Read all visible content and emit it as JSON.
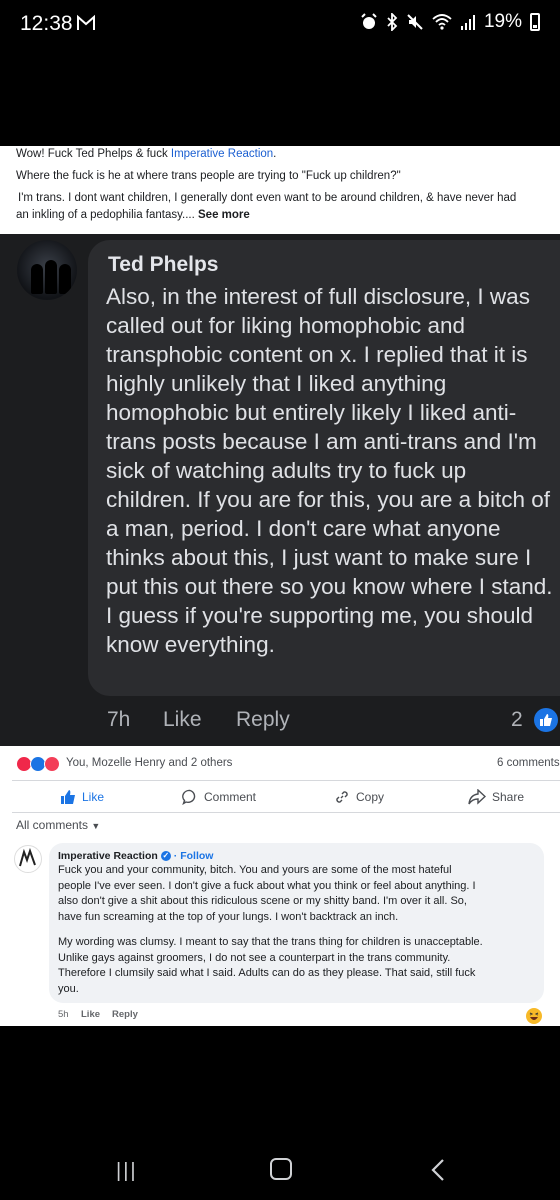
{
  "status_bar": {
    "time": "12:38",
    "battery": "19%"
  },
  "post": {
    "line1_a": "Wow!  Fuck Ted Phelps & fuck ",
    "line1_link": "Imperative Reaction",
    "line1_b": ".",
    "line2": "Where the fuck is he at where trans people are trying to \"Fuck up children?\"",
    "line3": "I'm trans. I dont want children, I generally dont even want to be around children, & have never had",
    "line4": "an inkling of a pedophilia fantasy....",
    "see_more": "See more"
  },
  "shared_comment": {
    "author": "Ted Phelps",
    "text": "Also, in the interest of full disclosure, I was called out for liking homophobic and transphobic content on x. I replied that it is highly unlikely that I liked anything homophobic but entirely likely I liked anti-trans posts because I am anti-trans and I'm sick of watching adults try to fuck up children. If you are for this, you are a bitch of a man, period. I don't care what anyone thinks about this, I just want to make sure I put this out there so you know where I stand. I guess if you're supporting me, you should know everything.",
    "time": "7h",
    "like": "Like",
    "reply": "Reply",
    "like_count": "2"
  },
  "reactions": {
    "summary": "You, Mozelle Henry and 2 others",
    "comments": "6 comments"
  },
  "actions": {
    "like": "Like",
    "comment": "Comment",
    "copy": "Copy",
    "share": "Share"
  },
  "all_comments": "All comments",
  "comment": {
    "author": "Imperative Reaction",
    "follow": "· Follow",
    "p1_lines": [
      "Fuck you and your community, bitch. You and yours are some of the most hateful",
      "people I've ever seen. I don't give a fuck about what you think or feel about anything. I",
      "also don't give a shit about this ridiculous scene or my shitty band. I'm over it all. So,",
      "have fun screaming at the top of your lungs. I won't backtrack an inch."
    ],
    "p2_lines": [
      "My wording was clumsy. I meant to say that the trans thing for children is unacceptable.",
      "Unlike gays against groomers, I do not see a counterpart in the trans community.",
      "Therefore I clumsily said what I said. Adults can do as they please. That said, still fuck",
      "you."
    ],
    "time": "5h",
    "like": "Like",
    "reply": "Reply"
  },
  "nav": {
    "recent": "|||"
  }
}
